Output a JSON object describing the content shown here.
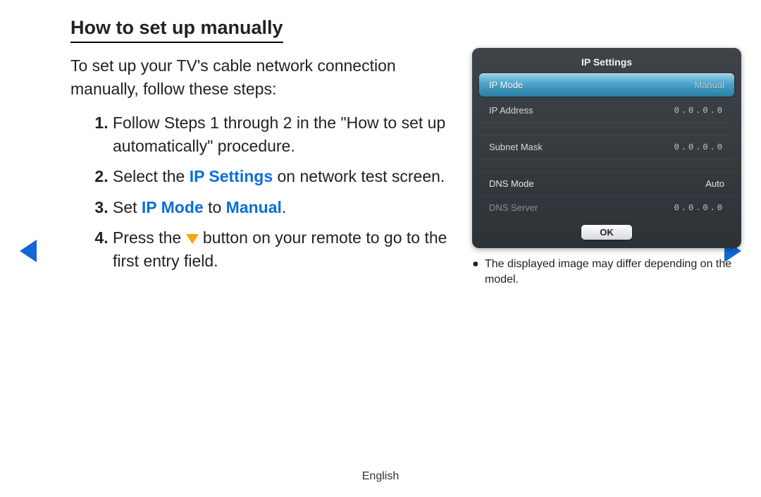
{
  "heading": "How to set up manually",
  "intro": "To set up your TV's cable network connection manually, follow these steps:",
  "steps": {
    "s1": "Follow Steps 1 through 2 in the \"How to set up automatically\" procedure.",
    "s2_a": "Select the ",
    "s2_b": "IP Settings",
    "s2_c": " on network test screen.",
    "s3_a": "Set ",
    "s3_b": "IP Mode",
    "s3_c": " to ",
    "s3_d": "Manual",
    "s3_e": ".",
    "s4_a": "Press the ",
    "s4_b": " button on your remote to go to the first entry field."
  },
  "tv": {
    "title": "IP Settings",
    "rows": {
      "ipmode": {
        "label": "IP Mode",
        "value": "Manual"
      },
      "ipaddr": {
        "label": "IP Address",
        "value": "0.0.0.0"
      },
      "subnet": {
        "label": "Subnet Mask",
        "value": "0.0.0.0"
      },
      "dnsmode": {
        "label": "DNS Mode",
        "value": "Auto"
      },
      "dnsserver": {
        "label": "DNS Server",
        "value": "0.0.0.0"
      }
    },
    "ok": "OK"
  },
  "note": "The displayed image may differ depending on the model.",
  "footer": "English"
}
